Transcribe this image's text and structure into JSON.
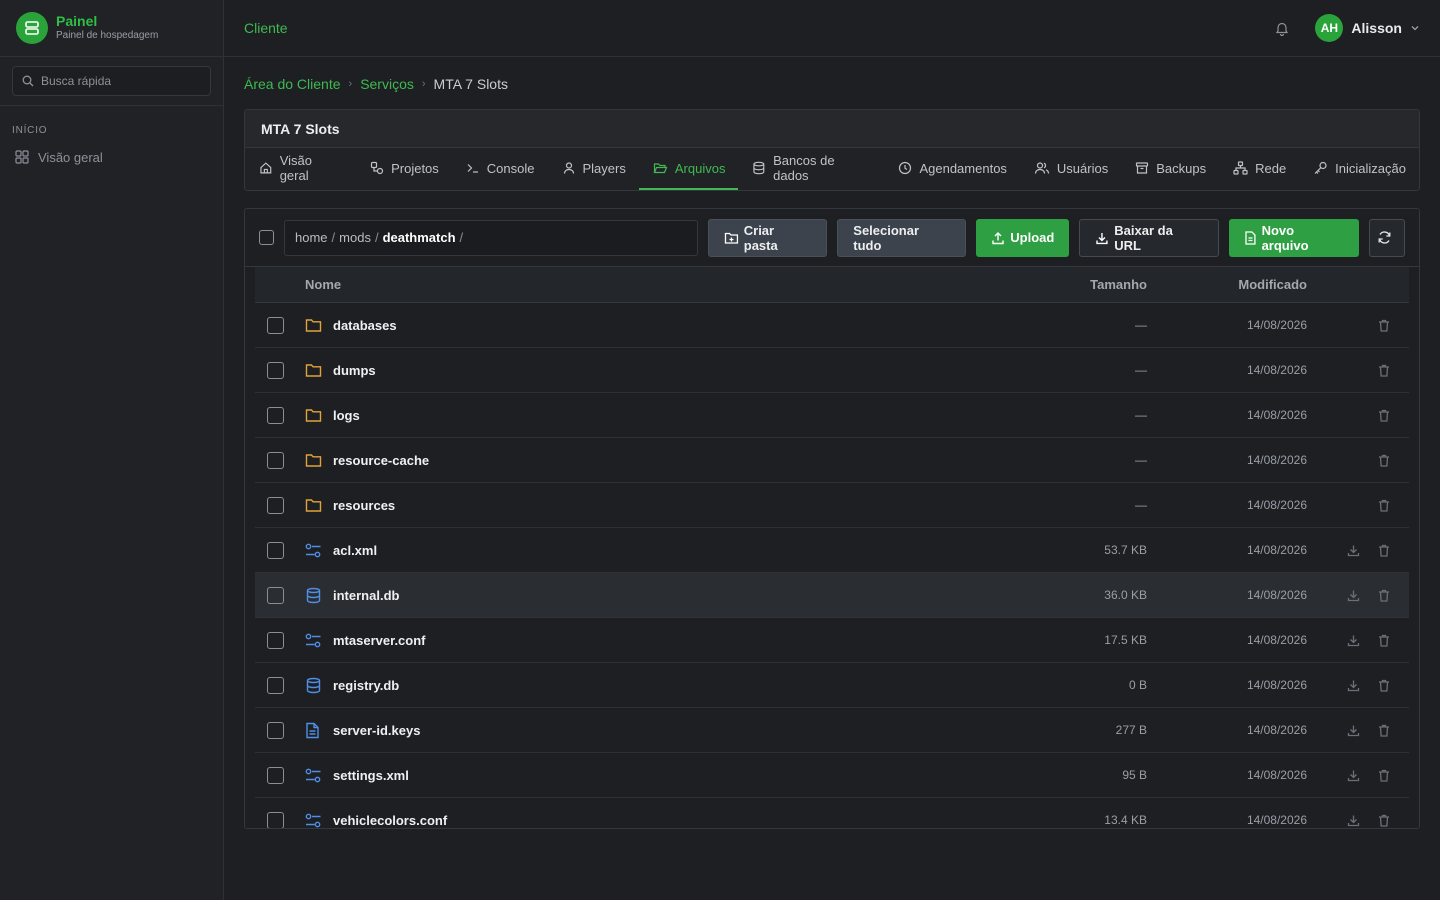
{
  "brand": {
    "title": "Painel",
    "subtitle": "Painel de hospedagem"
  },
  "sidebar": {
    "search_placeholder": "Busca rápida",
    "section_label": "INÍCIO",
    "items": [
      {
        "label": "Visão geral",
        "icon": "grid-icon"
      }
    ]
  },
  "topbar": {
    "title": "Cliente",
    "user_initials": "AH",
    "user_name": "Alisson"
  },
  "breadcrumb": [
    "Área do Cliente",
    "Serviços",
    "MTA 7 Slots"
  ],
  "service": {
    "title": "MTA 7 Slots",
    "tabs": [
      {
        "label": "Visão geral",
        "icon": "home-icon"
      },
      {
        "label": "Projetos",
        "icon": "projects-icon"
      },
      {
        "label": "Console",
        "icon": "terminal-icon"
      },
      {
        "label": "Players",
        "icon": "user-icon"
      },
      {
        "label": "Arquivos",
        "icon": "folder-icon",
        "active": true
      },
      {
        "label": "Bancos de dados",
        "icon": "database-icon"
      },
      {
        "label": "Agendamentos",
        "icon": "clock-icon"
      },
      {
        "label": "Usuários",
        "icon": "users-icon"
      },
      {
        "label": "Backups",
        "icon": "archive-icon"
      },
      {
        "label": "Rede",
        "icon": "network-icon"
      },
      {
        "label": "Inicialização",
        "icon": "key-icon"
      }
    ]
  },
  "file_manager": {
    "path": {
      "p1": "home",
      "p2": "mods",
      "current": "deathmatch",
      "sep": "/"
    },
    "buttons": {
      "new_folder": "Criar pasta",
      "select_all": "Selecionar tudo",
      "upload": "Upload",
      "download_url": "Baixar da URL",
      "new_file": "Novo arquivo"
    },
    "columns": {
      "name": "Nome",
      "size": "Tamanho",
      "modified": "Modificado"
    },
    "files": [
      {
        "name": "databases",
        "size": "—",
        "modified": "14/08/2026",
        "type": "folder"
      },
      {
        "name": "dumps",
        "size": "—",
        "modified": "14/08/2026",
        "type": "folder"
      },
      {
        "name": "logs",
        "size": "—",
        "modified": "14/08/2026",
        "type": "folder"
      },
      {
        "name": "resource-cache",
        "size": "—",
        "modified": "14/08/2026",
        "type": "folder"
      },
      {
        "name": "resources",
        "size": "—",
        "modified": "14/08/2026",
        "type": "folder"
      },
      {
        "name": "acl.xml",
        "size": "53.7 KB",
        "modified": "14/08/2026",
        "type": "config"
      },
      {
        "name": "internal.db",
        "size": "36.0 KB",
        "modified": "14/08/2026",
        "type": "db"
      },
      {
        "name": "mtaserver.conf",
        "size": "17.5 KB",
        "modified": "14/08/2026",
        "type": "config"
      },
      {
        "name": "registry.db",
        "size": "0 B",
        "modified": "14/08/2026",
        "type": "db"
      },
      {
        "name": "server-id.keys",
        "size": "277 B",
        "modified": "14/08/2026",
        "type": "text"
      },
      {
        "name": "settings.xml",
        "size": "95 B",
        "modified": "14/08/2026",
        "type": "config"
      },
      {
        "name": "vehiclecolors.conf",
        "size": "13.4 KB",
        "modified": "14/08/2026",
        "type": "config"
      }
    ],
    "highlighted_row": "internal.db"
  },
  "colors": {
    "accent": "#2ea043",
    "folder": "#e3a33b",
    "file": "#4f8fe6"
  }
}
